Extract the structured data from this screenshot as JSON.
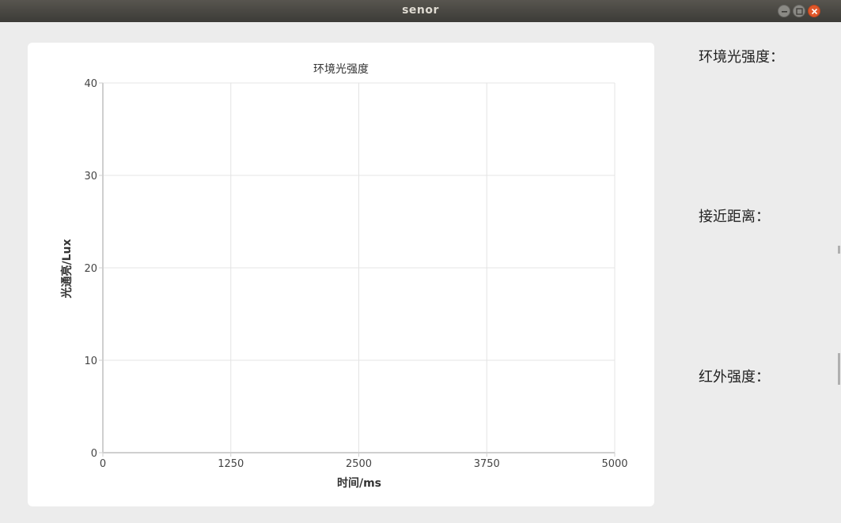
{
  "window": {
    "title": "senor",
    "buttons": [
      "minimize",
      "maximize",
      "close"
    ]
  },
  "colors": {
    "titlebar": "#3c3b37",
    "background": "#ececec",
    "close": "#e0572a",
    "grid": "#e4e4e4",
    "axis": "#cfcfcf"
  },
  "chart_data": {
    "type": "line",
    "title": "环境光强度",
    "xlabel": "时间/ms",
    "ylabel": "光通亮/Lux",
    "xlim": [
      0,
      5000
    ],
    "ylim": [
      0,
      40
    ],
    "xticks": [
      "0",
      "1250",
      "2500",
      "3750",
      "5000"
    ],
    "yticks": [
      "0",
      "10",
      "20",
      "30",
      "40"
    ],
    "grid": true,
    "series": []
  },
  "readings": {
    "ambient_label": "环境光强度：",
    "proximity_label": "接近距离：",
    "infrared_label": "红外强度："
  }
}
